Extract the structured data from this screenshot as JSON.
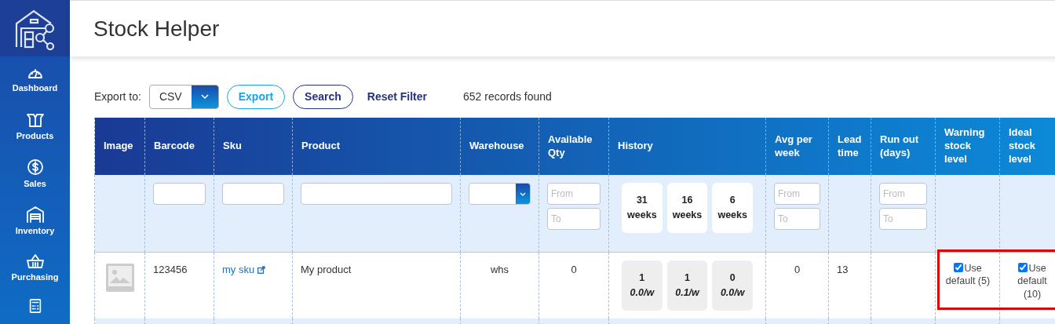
{
  "sidebar": {
    "items": [
      {
        "kind": "labeled",
        "label": "Dashboard"
      },
      {
        "kind": "labeled",
        "label": "Products"
      },
      {
        "kind": "labeled",
        "label": "Sales"
      },
      {
        "kind": "labeled",
        "label": "Inventory"
      },
      {
        "kind": "labeled",
        "label": "Purchasing"
      },
      {
        "kind": "icon_only"
      }
    ]
  },
  "header": {
    "title": "Stock Helper"
  },
  "toolbar": {
    "export_label": "Export to:",
    "export_format": "CSV",
    "export_button": "Export",
    "search_button": "Search",
    "reset_link": "Reset Filter",
    "records": "652 records found"
  },
  "table": {
    "columns": [
      "Image",
      "Barcode",
      "Sku",
      "Product",
      "Warehouse",
      "Available Qty",
      "History",
      "Avg per week",
      "Lead time",
      "Run out (days)",
      "Warning stock level",
      "Ideal stock level"
    ],
    "filters": [
      {
        "kind": "none"
      },
      {
        "kind": "text"
      },
      {
        "kind": "text"
      },
      {
        "kind": "text"
      },
      {
        "kind": "select"
      },
      {
        "kind": "range",
        "from_placeholder": "From",
        "to_placeholder": "To"
      },
      {
        "kind": "periods",
        "periods": [
          "31 weeks",
          "16 weeks",
          "6 weeks"
        ]
      },
      {
        "kind": "range",
        "from_placeholder": "From",
        "to_placeholder": "To"
      },
      {
        "kind": "none"
      },
      {
        "kind": "range",
        "from_placeholder": "From",
        "to_placeholder": "To"
      },
      {
        "kind": "none"
      },
      {
        "kind": "none"
      }
    ],
    "rows": [
      {
        "cells": [
          {
            "kind": "image"
          },
          {
            "kind": "text",
            "text": "123456"
          },
          {
            "kind": "link",
            "text": "my sku"
          },
          {
            "kind": "text",
            "text": "My product"
          },
          {
            "kind": "center",
            "text": "whs"
          },
          {
            "kind": "center",
            "text": "0"
          },
          {
            "kind": "history",
            "periods": [
              {
                "count": "1",
                "rate": "0.0/w"
              },
              {
                "count": "1",
                "rate": "0.1/w"
              },
              {
                "count": "0",
                "rate": "0.0/w"
              }
            ]
          },
          {
            "kind": "center",
            "text": "0"
          },
          {
            "kind": "text",
            "text": "13"
          },
          {
            "kind": "empty"
          },
          {
            "kind": "checkbox",
            "label": "Use default (5)",
            "checked": true,
            "highlighted": true
          },
          {
            "kind": "checkbox",
            "label": "Use default (10)",
            "checked": true,
            "highlighted": true
          }
        ]
      }
    ]
  }
}
